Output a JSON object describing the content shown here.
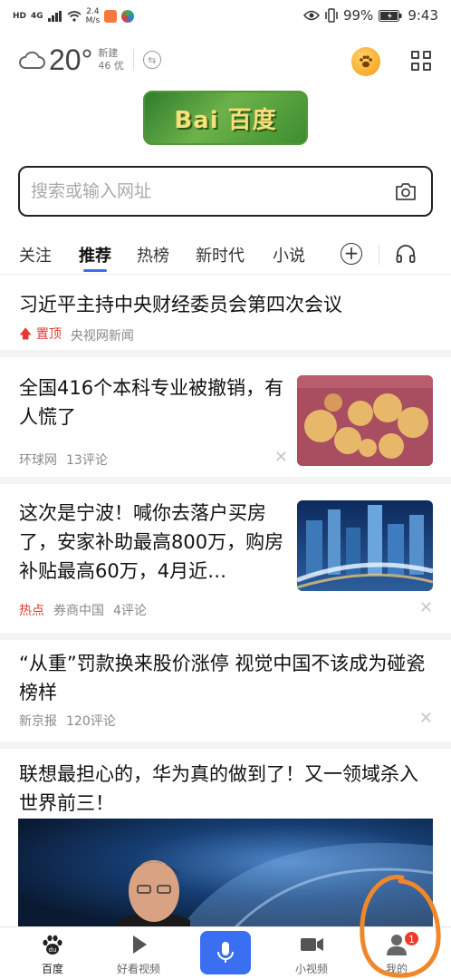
{
  "status_bar": {
    "network": "HD",
    "signal": "4G",
    "speed_value": "2.4",
    "speed_unit": "M/s",
    "battery": "99%",
    "time": "9:43"
  },
  "weather": {
    "icon": "cloud-icon",
    "temperature": "20°",
    "location": "新建",
    "aqi": "46 优"
  },
  "logo_text": "Bai 百度",
  "search": {
    "placeholder": "搜索或输入网址"
  },
  "tabs": [
    {
      "label": "关注"
    },
    {
      "label": "推荐"
    },
    {
      "label": "热榜"
    },
    {
      "label": "新时代"
    },
    {
      "label": "小说"
    }
  ],
  "feed": [
    {
      "title": "习近平主持中央财经委员会第四次会议",
      "pin_label": "置顶",
      "source": "央视网新闻"
    },
    {
      "title": "全国416个本科专业被撤销，有人慌了",
      "source": "环球网",
      "comments": "13评论"
    },
    {
      "title": "这次是宁波！喊你去落户买房了，安家补助最高800万，购房补贴最高60万，4月近…",
      "hot_label": "热点",
      "source": "券商中国",
      "comments": "4评论"
    },
    {
      "title": "“从重”罚款换来股价涨停 视觉中国不该成为碰瓷榜样",
      "source": "新京报",
      "comments": "120评论"
    },
    {
      "title": "联想最担心的，华为真的做到了！又一领域杀入世界前三！"
    }
  ],
  "bottom_nav": [
    {
      "label": "百度",
      "icon": "baidu-paw-icon"
    },
    {
      "label": "好看视频",
      "icon": "play-icon"
    },
    {
      "label": "",
      "icon": "microphone-icon"
    },
    {
      "label": "小视频",
      "icon": "video-camera-icon"
    },
    {
      "label": "我的",
      "icon": "user-icon",
      "badge": "1"
    }
  ],
  "colors": {
    "accent": "#3a6ff2",
    "hot": "#e43a30",
    "annotation": "#f0872a"
  }
}
